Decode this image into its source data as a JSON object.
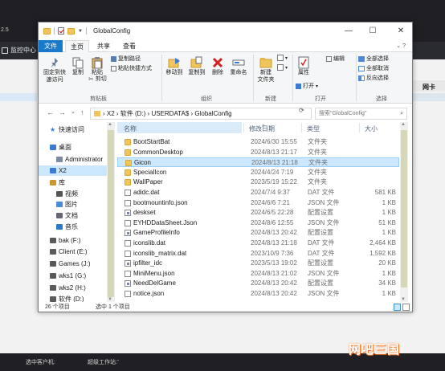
{
  "background_app": {
    "version_text": "2.5",
    "nav_item": "监控中心",
    "net_column": "网卡",
    "status_selected": "选中客户机:",
    "status_super": "超级工作站:",
    "status_dots": "-",
    "watermark": "网吧三国"
  },
  "window": {
    "title": "GlobalConfig",
    "controls": {
      "minimize": "—",
      "maximize": "☐",
      "close": "✕"
    }
  },
  "ribbon_tabs": {
    "file": "文件",
    "home": "主页",
    "share": "共享",
    "view": "查看",
    "expand": "⌄ ?"
  },
  "ribbon": {
    "pin_quick": "固定到快\n速访问",
    "copy": "复制",
    "paste": "粘贴",
    "copy_path": "复制路径",
    "paste_shortcut": "粘贴快捷方式",
    "cut": "剪切",
    "clipboard": "剪贴板",
    "move_to": "移动到",
    "copy_to": "复制到",
    "delete": "删除",
    "rename": "重命名",
    "organize": "组织",
    "new_folder": "新建\n文件夹",
    "new_group": "新建",
    "properties": "属性",
    "open": "打开",
    "edit": "编辑",
    "open_group": "打开",
    "select_all": "全部选择",
    "select_none": "全部取消",
    "invert": "反向选择",
    "select_group": "选择"
  },
  "address": {
    "back": "←",
    "forward": "→",
    "recent": "⌄",
    "up": "↑",
    "path": "›  X2  ›  软件 (D:)  ›  USERDATA$  ›  GlobalConfig",
    "refresh": "⟳",
    "search_placeholder": "搜索\"GlobalConfig\"",
    "search_icon": "⌕"
  },
  "nav_pane": [
    {
      "label": "快速访问",
      "icon": "star",
      "selected": false
    },
    {
      "label": "桌面",
      "icon": "desktop",
      "selected": false
    },
    {
      "label": "Administrator",
      "icon": "user",
      "selected": false
    },
    {
      "label": "X2",
      "icon": "pc",
      "selected": true
    },
    {
      "label": "库",
      "icon": "library",
      "selected": false
    },
    {
      "label": "视频",
      "icon": "video",
      "selected": false
    },
    {
      "label": "图片",
      "icon": "picture",
      "selected": false
    },
    {
      "label": "文档",
      "icon": "document",
      "selected": false
    },
    {
      "label": "音乐",
      "icon": "music",
      "selected": false
    },
    {
      "label": "bak (F:)",
      "icon": "drive",
      "selected": false
    },
    {
      "label": "Client (E:)",
      "icon": "drive",
      "selected": false
    },
    {
      "label": "Games (J:)",
      "icon": "drive",
      "selected": false
    },
    {
      "label": "wks1 (G:)",
      "icon": "drive",
      "selected": false
    },
    {
      "label": "wks2 (H:)",
      "icon": "drive",
      "selected": false
    },
    {
      "label": "软件 (D:)",
      "icon": "drive",
      "selected": false
    }
  ],
  "columns": {
    "name": "名称",
    "date": "修改日期",
    "type": "类型",
    "size": "大小",
    "sort_caret": "^"
  },
  "files": [
    {
      "name": "BootStartBat",
      "date": "2024/6/30 15:55",
      "type": "文件夹",
      "size": "",
      "kind": "folder",
      "selected": false
    },
    {
      "name": "CommonDesktop",
      "date": "2024/8/13 21:17",
      "type": "文件夹",
      "size": "",
      "kind": "folder",
      "selected": false
    },
    {
      "name": "Gicon",
      "date": "2024/8/13 21:18",
      "type": "文件夹",
      "size": "",
      "kind": "folder",
      "selected": true
    },
    {
      "name": "SpecialIcon",
      "date": "2024/4/24 7:19",
      "type": "文件夹",
      "size": "",
      "kind": "folder",
      "selected": false
    },
    {
      "name": "WallPaper",
      "date": "2023/5/19 15:22",
      "type": "文件夹",
      "size": "",
      "kind": "folder",
      "selected": false
    },
    {
      "name": "adidc.dat",
      "date": "2024/7/4 9:37",
      "type": "DAT 文件",
      "size": "581 KB",
      "kind": "doc",
      "selected": false
    },
    {
      "name": "bootmountinfo.json",
      "date": "2024/6/6 7:21",
      "type": "JSON 文件",
      "size": "1 KB",
      "kind": "doc",
      "selected": false
    },
    {
      "name": "deskset",
      "date": "2024/6/5 22:28",
      "type": "配置设置",
      "size": "1 KB",
      "kind": "cfg",
      "selected": false
    },
    {
      "name": "EYHDDataSheet.Json",
      "date": "2024/8/6 12:55",
      "type": "JSON 文件",
      "size": "51 KB",
      "kind": "doc",
      "selected": false
    },
    {
      "name": "GameProfileInfo",
      "date": "2024/8/13 20:42",
      "type": "配置设置",
      "size": "1 KB",
      "kind": "cfg",
      "selected": false
    },
    {
      "name": "iconslib.dat",
      "date": "2024/8/13 21:18",
      "type": "DAT 文件",
      "size": "2,464 KB",
      "kind": "doc",
      "selected": false
    },
    {
      "name": "iconslib_matrix.dat",
      "date": "2023/10/9 7:36",
      "type": "DAT 文件",
      "size": "1,592 KB",
      "kind": "doc",
      "selected": false
    },
    {
      "name": "ipfilter_idc",
      "date": "2023/5/13 19:02",
      "type": "配置设置",
      "size": "20 KB",
      "kind": "cfg",
      "selected": false
    },
    {
      "name": "MiniMenu.json",
      "date": "2024/8/13 21:02",
      "type": "JSON 文件",
      "size": "1 KB",
      "kind": "doc",
      "selected": false
    },
    {
      "name": "NeedDelGame",
      "date": "2024/8/13 20:42",
      "type": "配置设置",
      "size": "34 KB",
      "kind": "cfg",
      "selected": false
    },
    {
      "name": "notice.json",
      "date": "2024/8/13 20:42",
      "type": "JSON 文件",
      "size": "1 KB",
      "kind": "doc",
      "selected": false
    }
  ],
  "status": {
    "count": "26 个项目",
    "selected": "选中 1 个项目"
  }
}
